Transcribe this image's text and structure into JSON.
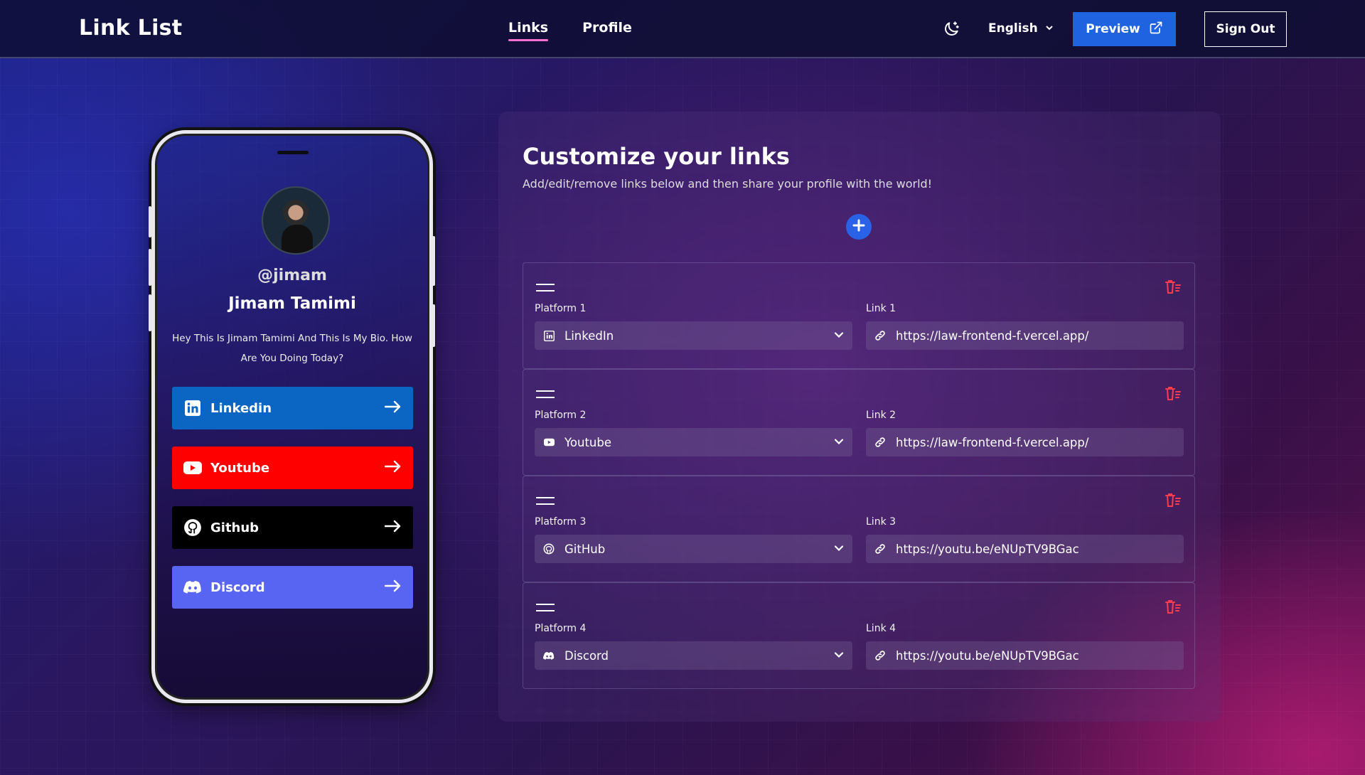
{
  "app": {
    "title": "Link List"
  },
  "nav": {
    "items": [
      {
        "label": "Links",
        "active": true
      },
      {
        "label": "Profile",
        "active": false
      }
    ]
  },
  "header": {
    "language": "English",
    "preview_label": "Preview",
    "signout_label": "Sign Out",
    "icons": {
      "theme": "moon-icon",
      "language": "chevron-down-icon",
      "preview": "external-link-icon"
    }
  },
  "profile": {
    "handle": "@jimam",
    "name": "Jimam Tamimi",
    "bio": "Hey This Is Jimam Tamimi And This Is My Bio. How Are You Doing Today?",
    "links": [
      {
        "label": "Linkedin",
        "color": "#0a66c2",
        "icon": "linkedin-icon"
      },
      {
        "label": "Youtube",
        "color": "#ff0000",
        "icon": "youtube-icon"
      },
      {
        "label": "Github",
        "color": "#000000",
        "icon": "github-icon"
      },
      {
        "label": "Discord",
        "color": "#5865f2",
        "icon": "discord-icon"
      }
    ]
  },
  "editor": {
    "title": "Customize your links",
    "subtitle": "Add/edit/remove links below and then share your profile with the world!",
    "links": [
      {
        "platform_label": "Platform 1",
        "platform": "LinkedIn",
        "link_label": "Link 1",
        "url": "https://law-frontend-f.vercel.app/"
      },
      {
        "platform_label": "Platform 2",
        "platform": "Youtube",
        "link_label": "Link 2",
        "url": "https://law-frontend-f.vercel.app/"
      },
      {
        "platform_label": "Platform 3",
        "platform": "GitHub",
        "link_label": "Link 3",
        "url": "https://youtu.be/eNUpTV9BGac"
      },
      {
        "platform_label": "Platform 4",
        "platform": "Discord",
        "link_label": "Link 4",
        "url": "https://youtu.be/eNUpTV9BGac"
      }
    ]
  },
  "colors": {
    "accent": "#2962e6",
    "delete": "#ff3b4f",
    "nav_underline": "#ff6fd0"
  }
}
